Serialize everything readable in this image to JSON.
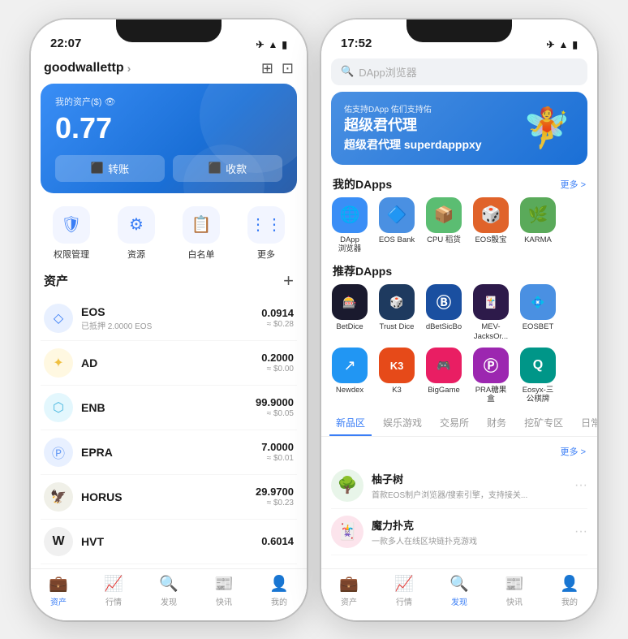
{
  "phone1": {
    "status": {
      "time": "22:07",
      "icons": [
        "✈",
        "WiFi",
        "🔋"
      ]
    },
    "header": {
      "title": "goodwallettp",
      "chevron": ">",
      "icons": [
        "⊞",
        "⊡"
      ]
    },
    "balance_card": {
      "label": "我的资产($) 👁",
      "amount": "0.77",
      "btn_transfer": "转账",
      "btn_receive": "收款"
    },
    "menu": [
      {
        "icon": "🛡",
        "label": "权限管理"
      },
      {
        "icon": "⚙",
        "label": "资源"
      },
      {
        "icon": "📋",
        "label": "白名单"
      },
      {
        "icon": "⋮⋮",
        "label": "更多"
      }
    ],
    "asset_section": {
      "title": "资产",
      "add": "+"
    },
    "assets": [
      {
        "icon": "◇",
        "name": "EOS",
        "sub": "已抵押 2.0000 EOS",
        "amount": "0.0914",
        "usd": "≈ $0.28",
        "color": "#6b9ef6"
      },
      {
        "icon": "✦",
        "name": "AD",
        "sub": "",
        "amount": "0.2000",
        "usd": "≈ $0.00",
        "color": "#f0c040"
      },
      {
        "icon": "⬡",
        "name": "ENB",
        "sub": "",
        "amount": "99.9000",
        "usd": "≈ $0.05",
        "color": "#4ab8e0"
      },
      {
        "icon": "Ⓟ",
        "name": "EPRA",
        "sub": "",
        "amount": "7.0000",
        "usd": "≈ $0.01",
        "color": "#6b9ef6"
      },
      {
        "icon": "🦅",
        "name": "HORUS",
        "sub": "",
        "amount": "29.9700",
        "usd": "≈ $0.23",
        "color": "#888"
      },
      {
        "icon": "W",
        "name": "HVT",
        "sub": "",
        "amount": "0.6014",
        "usd": "",
        "color": "#1a1a1a"
      }
    ],
    "tabs": [
      {
        "icon": "💼",
        "label": "资产",
        "active": true
      },
      {
        "icon": "📈",
        "label": "行情",
        "active": false
      },
      {
        "icon": "🔍",
        "label": "发现",
        "active": false
      },
      {
        "icon": "📰",
        "label": "快讯",
        "active": false
      },
      {
        "icon": "👤",
        "label": "我的",
        "active": false
      }
    ]
  },
  "phone2": {
    "status": {
      "time": "17:52",
      "icons": [
        "✈",
        "WiFi",
        "🔋"
      ]
    },
    "search_placeholder": "DApp浏览器",
    "banner": {
      "sub": "佑支持DApp  佑们支持佑",
      "title": "超级君代理\nsuperdapppxy",
      "figure": "🧚"
    },
    "my_dapps": {
      "title": "我的DApps",
      "more": "更多 >",
      "items": [
        {
          "label": "DApp\n浏览器",
          "bg": "#3a8ef6",
          "icon": "🌐"
        },
        {
          "label": "EOS Bank",
          "bg": "#4a90e2",
          "icon": "🔷"
        },
        {
          "label": "CPU 稻货",
          "bg": "#5bbd72",
          "icon": "📦"
        },
        {
          "label": "EOS骰宝",
          "bg": "#e0632a",
          "icon": "🎲"
        },
        {
          "label": "KARMA",
          "bg": "#5aaa5a",
          "icon": "🌿"
        }
      ]
    },
    "recommended_dapps": {
      "title": "推荐DApps",
      "items": [
        {
          "label": "BetDice",
          "bg": "#1a1a2e",
          "icon": "🎰"
        },
        {
          "label": "Trust Dice",
          "bg": "#1e3a5f",
          "icon": "🎲"
        },
        {
          "label": "dBetSicBo",
          "bg": "#1a4fa0",
          "icon": "Ⓑ"
        },
        {
          "label": "MEV-\nJacksOr...",
          "bg": "#2d1a4a",
          "icon": "🃏"
        },
        {
          "label": "EOSBET",
          "bg": "#4a90e2",
          "icon": "💠"
        },
        {
          "label": "Newdex",
          "bg": "#2196f3",
          "icon": "↗"
        },
        {
          "label": "K3",
          "bg": "#e64a19",
          "icon": "K3"
        },
        {
          "label": "BigGame",
          "bg": "#e91e63",
          "icon": "🎮"
        },
        {
          "label": "PRA糖果盒",
          "bg": "#9c27b0",
          "icon": "Ⓟ"
        },
        {
          "label": "Eosyx-三\n公棋牌",
          "bg": "#009688",
          "icon": "Q"
        }
      ]
    },
    "tabs_filter": [
      {
        "label": "新品区",
        "active": true
      },
      {
        "label": "娱乐游戏",
        "active": false
      },
      {
        "label": "交易所",
        "active": false
      },
      {
        "label": "财务",
        "active": false
      },
      {
        "label": "挖矿专区",
        "active": false
      },
      {
        "label": "日常工...",
        "active": false
      }
    ],
    "new_apps_more": "更多 >",
    "new_apps": [
      {
        "icon": "🌳",
        "name": "柚子树",
        "desc": "首款EOS制户浏览器/搜索引擎，支持接关...",
        "iconbg": "#e8f5e9"
      },
      {
        "icon": "🃏",
        "name": "魔力扑克",
        "desc": "一款多人在线区块链扑克游戏",
        "iconbg": "#fce4ec"
      }
    ],
    "bottom_tabs": [
      {
        "icon": "💼",
        "label": "资产",
        "active": false
      },
      {
        "icon": "📈",
        "label": "行情",
        "active": false
      },
      {
        "icon": "🔍",
        "label": "发现",
        "active": true
      },
      {
        "icon": "📰",
        "label": "快讯",
        "active": false
      },
      {
        "icon": "👤",
        "label": "我的",
        "active": false
      }
    ]
  }
}
